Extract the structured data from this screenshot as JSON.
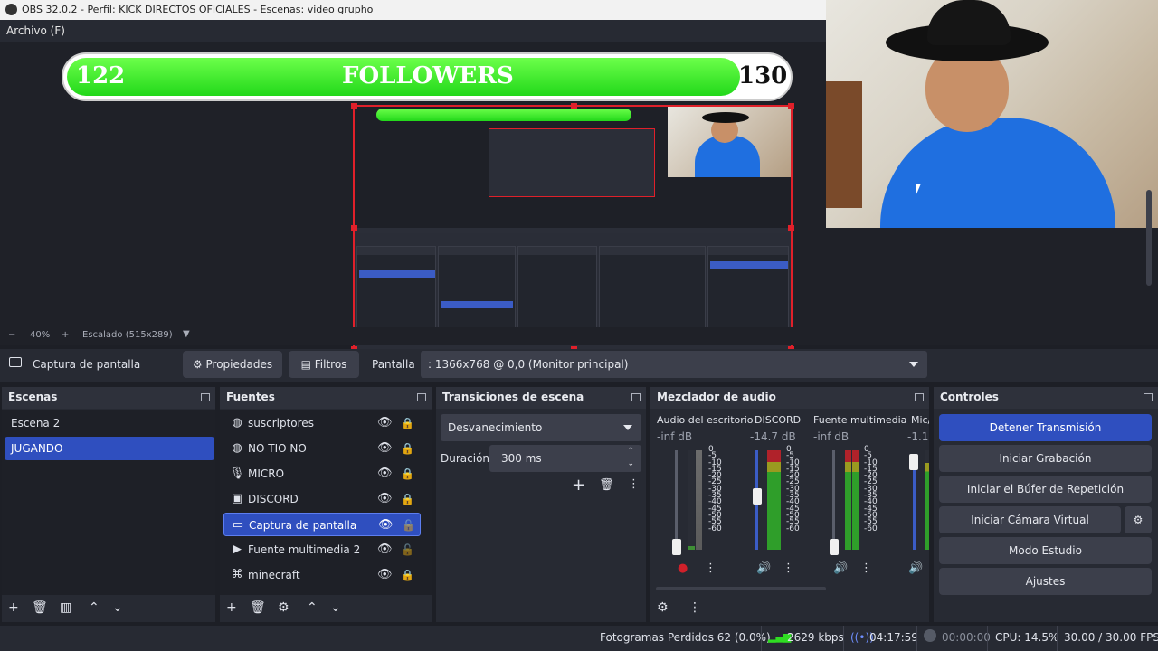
{
  "window": {
    "title": "OBS 32.0.2 - Perfil: KICK DIRECTOS OFICIALES - Escenas: video grupho"
  },
  "menu": {
    "archivo": "Archivo (F)"
  },
  "overlay": {
    "left_count": "122",
    "label": "FOLLOWERS",
    "right_count": "130",
    "progress": 0.93
  },
  "zoom": {
    "minus": "−",
    "level": "40%",
    "plus": "+",
    "scaling": "Escalado (515x289)"
  },
  "source_bar": {
    "selected_source": "Captura de pantalla",
    "properties": "Propiedades",
    "filters": "Filtros",
    "screen_label": "Pantalla",
    "screen_value": ": 1366x768 @ 0,0 (Monitor principal)"
  },
  "scenes": {
    "title": "Escenas",
    "items": [
      {
        "label": "Escena 2",
        "selected": false
      },
      {
        "label": "JUGANDO",
        "selected": true
      }
    ]
  },
  "sources": {
    "title": "Fuentes",
    "items": [
      {
        "label": "suscriptores",
        "icon": "globe-icon"
      },
      {
        "label": "NO TIO NO",
        "icon": "globe-icon"
      },
      {
        "label": "MICRO",
        "icon": "microphone-icon"
      },
      {
        "label": "DISCORD",
        "icon": "window-capture-icon"
      },
      {
        "label": "Captura de pantalla",
        "icon": "monitor-icon"
      },
      {
        "label": "Fuente multimedia 2",
        "icon": "play-icon"
      },
      {
        "label": "minecraft",
        "icon": "gamepad-icon"
      }
    ]
  },
  "transitions": {
    "title": "Transiciones de escena",
    "transition": "Desvanecimiento",
    "duration_label": "Duración",
    "duration_value": "300 ms"
  },
  "mixer": {
    "title": "Mezclador de audio",
    "scale": [
      "0",
      "-5",
      "-10",
      "-15",
      "-20",
      "-25",
      "-30",
      "-35",
      "-40",
      "-45",
      "-50",
      "-55",
      "-60"
    ],
    "channels": [
      {
        "name": "Audio del escritorio",
        "db": "-inf dB"
      },
      {
        "name": "DISCORD",
        "db": "-14.7 dB"
      },
      {
        "name": "Fuente multimedia",
        "db": "-inf dB"
      },
      {
        "name": "Mic/",
        "db": "-1.1"
      }
    ]
  },
  "controls": {
    "title": "Controles",
    "stop_stream": "Detener Transmisión",
    "start_recording": "Iniciar Grabación",
    "replay_buffer": "Iniciar el Búfer de Repetición",
    "virtual_camera": "Iniciar Cámara Virtual",
    "studio_mode": "Modo Estudio",
    "settings": "Ajustes"
  },
  "status": {
    "dropped_frames": "Fotogramas Perdidos 62 (0.0%)",
    "bitrate": "2629 kbps",
    "stream_time": "04:17:59",
    "record_time": "00:00:00",
    "cpu": "CPU: 14.5%",
    "fps": "30.00 / 30.00 FPS"
  },
  "colors": {
    "accent": "#2f4fbf",
    "live_green": "#2fdd22",
    "border_red": "#e0202a"
  }
}
